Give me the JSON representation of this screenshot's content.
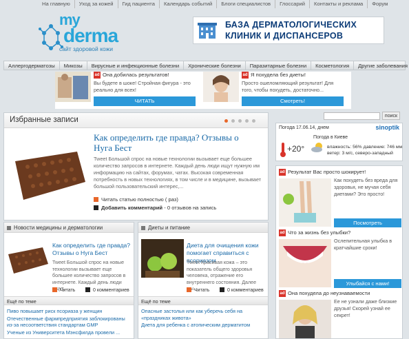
{
  "top_nav": [
    "На главную",
    "Уход за кожей",
    "Гид пациента",
    "Календарь событий",
    "Блоги специалистов",
    "Глоссарий",
    "Контакты и реклама",
    "Форум"
  ],
  "logo": {
    "my": "my",
    "derma": "derma",
    "tagline": "сайт здоровой кожи"
  },
  "banner": {
    "line1": "БАЗА ДЕРМАТОЛОГИЧЕСКИХ",
    "line2": "КЛИНИК И ДИСПАНСЕРОВ"
  },
  "categories": [
    "Аллергодерматозы",
    "Микозы",
    "Вирусные и инфекционные болезни",
    "Хронические болезни",
    "Паразитарные болезни",
    "Косметология",
    "Другие заболевания"
  ],
  "ads": [
    {
      "title": "Она добилась результатов!",
      "desc": "Вы будете в шоке! Стройная фигура - это реально для всех!",
      "button": "ЧИТАТЬ",
      "icon": "diet-photo"
    },
    {
      "title": "Я похудела без диеты!",
      "desc": "Просто ошеломляющий результат! Для того, чтобы похудеть, достаточно...",
      "button": "Смотреть!",
      "icon": "woman-photo"
    }
  ],
  "featured": {
    "header": "Избранные записи",
    "title": "Как определить где правда? Отзывы о Нуга Бест",
    "text": "Tweet Большой спрос на новые технологии вызывает еще большее количество запросов в интернете. Каждый день люди ищут нужную им информацию на сайтах, форумах, чатах. Высокая современная потребность в новых технологиях, в том числе и в медицине, вызывает большой пользовательский интерес,...",
    "read_full": "Читать статью полностью",
    "read_count": "( раз)",
    "add_comment": "Добавить комментарий",
    "comments": "- 0 отзывов на запись"
  },
  "search": {
    "button": "поиск",
    "placeholder": ""
  },
  "weather": {
    "date": "Погода 17.06.14, днем",
    "brand": "sinoptik",
    "city": "Погода в Киеве",
    "temp": "+20°",
    "humidity": "влажность: 56%  давление: 746 мм",
    "wind": "ветер: 3 м/с, северо-западный"
  },
  "right_ads": [
    {
      "title": "Результат Вас просто шокирует!",
      "desc": "Как похудеть без вреда для здоровья, не мучая себя диетами? Это просто!",
      "button": "Посмотреть",
      "icon": "scale-photo"
    },
    {
      "title": "Что за жизнь без улыбки?",
      "desc": "Ослепительная улыбка в кратчайшие сроки!",
      "button": "Улыбайся с нами!",
      "icon": "smile-photo"
    },
    {
      "title": "Она похудела до неузнаваемости",
      "desc": "Ее не узнали даже близкие друзья! Скорей узнай ее секрет!",
      "button": "",
      "icon": "woman-photo"
    }
  ],
  "col1": {
    "header": "Новости медицины и дерматологии",
    "title": "Как определить где правда? Отзывы о Нуга Бест",
    "text": "Tweet Большой спрос на новые технологии вызывает еще большее количество запросов в интернете. Каждый день люди ищут...",
    "read": "Читать",
    "comments": "0 комментариев",
    "more": "Ещё по теме",
    "links": [
      "Пиво повышает риск псориаза у женщин",
      "Отечественные фармпредприятия заблокированы из-за несоответствия стандартам GMP",
      "Ученые из Университета Мэнсфилда провели ..."
    ]
  },
  "col2": {
    "header": "Диеты и питание",
    "title": "Диета для очищения кожи помогает справиться с псориазом",
    "text": "Tweet Красивая кожа – это показатель общего здоровья человека, отражение его внутреннего состояния. Далее мы...",
    "read": "Читать",
    "comments": "0 комментариев",
    "more": "Ещё по теме",
    "links": [
      "Опасные застолья или как уберечь себя на «праздниках живота»",
      "Диета для ребенка с атопическим дерматитом"
    ]
  },
  "colors": {
    "accent": "#2b98d9",
    "brand": "#29a6d9",
    "link": "#1a6aa8",
    "ad_badge": "#d9342b",
    "orange": "#e8672a"
  }
}
